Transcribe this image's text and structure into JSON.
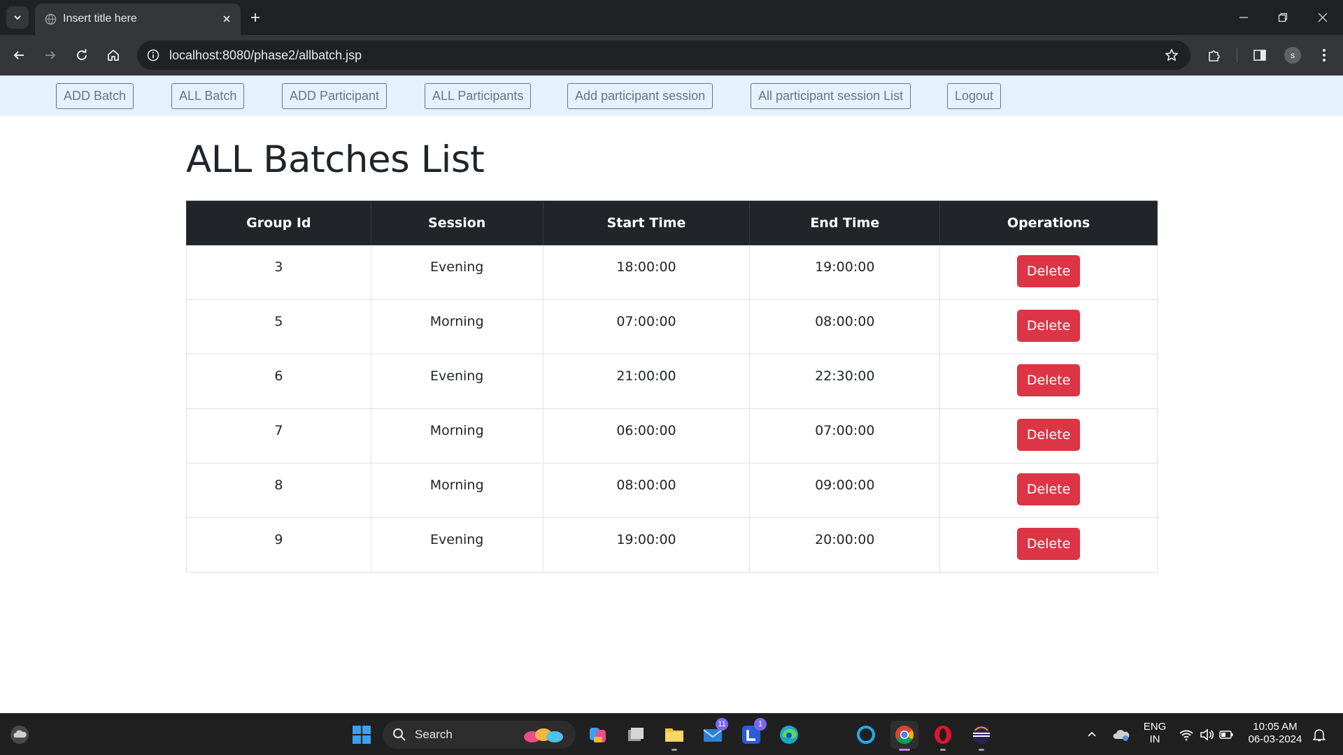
{
  "browser": {
    "tab_title": "Insert title here",
    "url": "localhost:8080/phase2/allbatch.jsp",
    "profile_initial": "s"
  },
  "nav": {
    "links": [
      {
        "label": "ADD Batch"
      },
      {
        "label": "ALL Batch"
      },
      {
        "label": "ADD Participant"
      },
      {
        "label": "ALL Participants"
      },
      {
        "label": "Add participant session"
      },
      {
        "label": "All participant session List"
      },
      {
        "label": "Logout"
      }
    ]
  },
  "page": {
    "title": "ALL Batches List"
  },
  "table": {
    "headers": [
      "Group Id",
      "Session",
      "Start Time",
      "End Time",
      "Operations"
    ],
    "delete_label": "Delete",
    "rows": [
      {
        "group_id": "3",
        "session": "Evening",
        "start": "18:00:00",
        "end": "19:00:00"
      },
      {
        "group_id": "5",
        "session": "Morning",
        "start": "07:00:00",
        "end": "08:00:00"
      },
      {
        "group_id": "6",
        "session": "Evening",
        "start": "21:00:00",
        "end": "22:30:00"
      },
      {
        "group_id": "7",
        "session": "Morning",
        "start": "06:00:00",
        "end": "07:00:00"
      },
      {
        "group_id": "8",
        "session": "Morning",
        "start": "08:00:00",
        "end": "09:00:00"
      },
      {
        "group_id": "9",
        "session": "Evening",
        "start": "19:00:00",
        "end": "20:00:00"
      }
    ]
  },
  "taskbar": {
    "search_placeholder": "Search",
    "mail_badge": "11",
    "l_badge": "1",
    "lang_top": "ENG",
    "lang_bottom": "IN",
    "time": "10:05 AM",
    "date": "06-03-2024"
  },
  "colors": {
    "nav_bg": "#e3f2fd",
    "table_header_bg": "#212529",
    "delete_bg": "#dc3545"
  }
}
